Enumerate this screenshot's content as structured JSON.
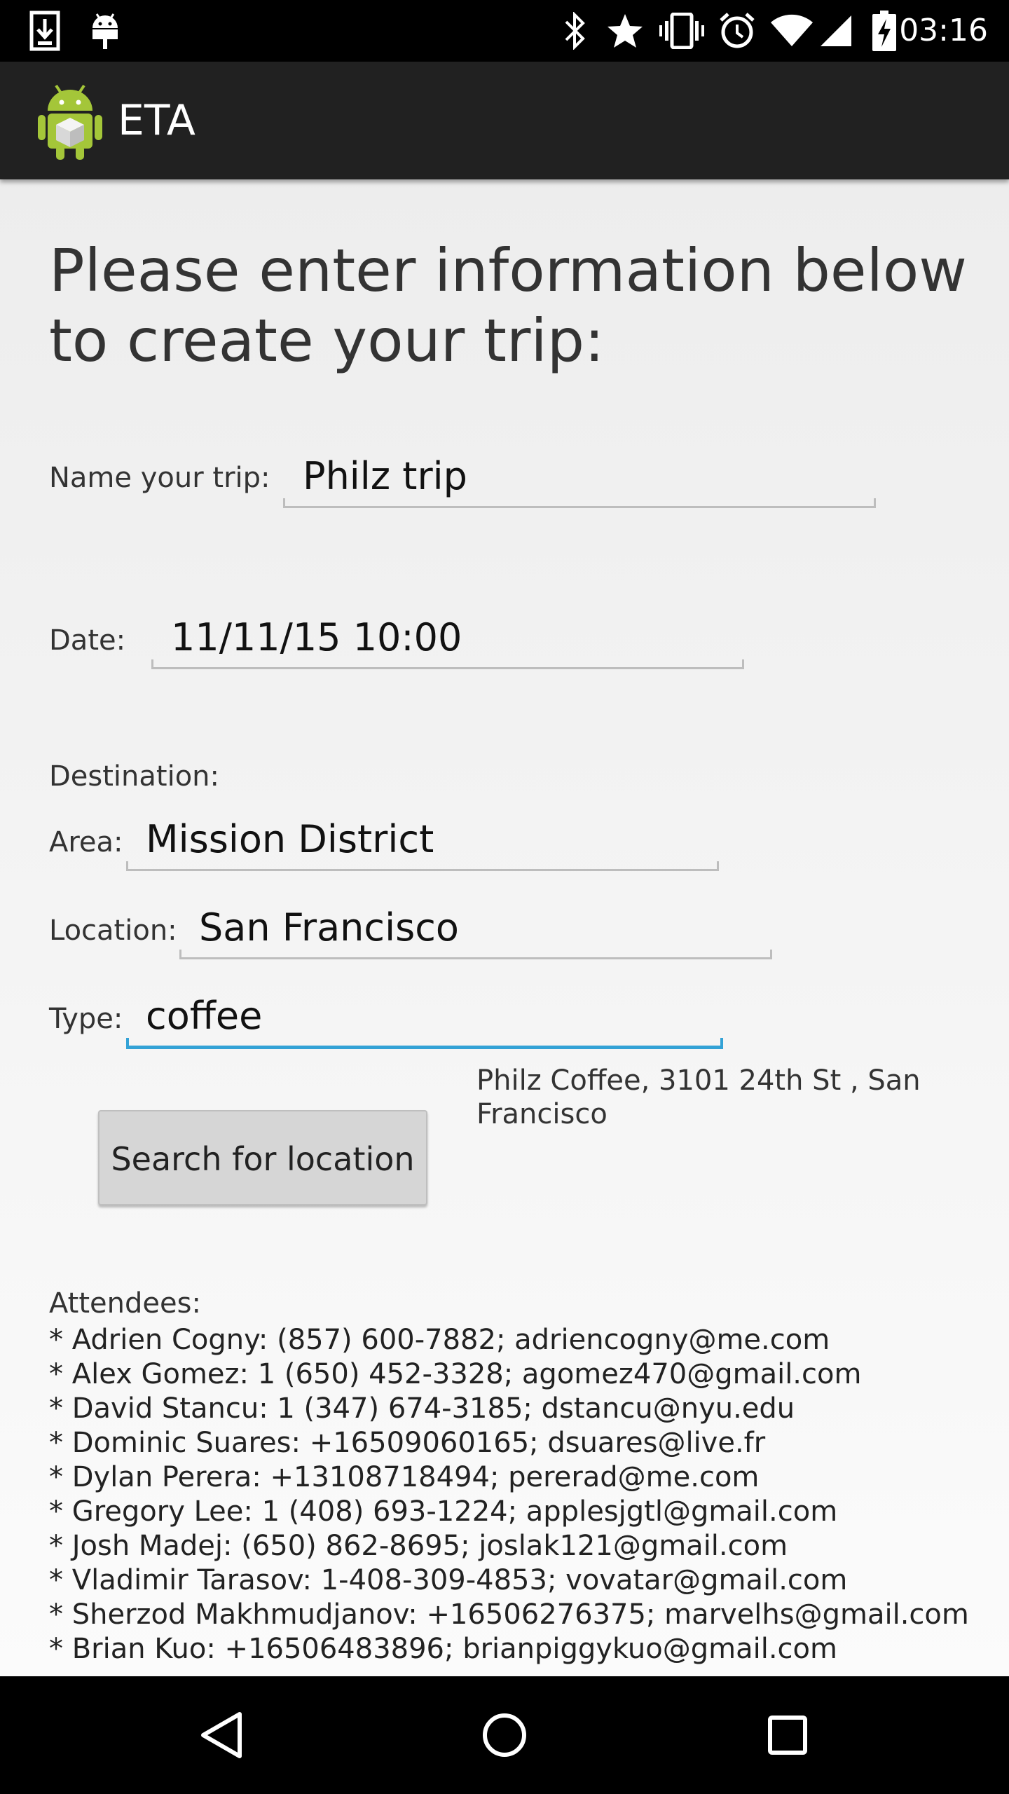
{
  "status_bar": {
    "time": "03:16",
    "left_icons": [
      "download-icon",
      "android-debug-icon"
    ],
    "right_icons": [
      "bluetooth-icon",
      "star-icon",
      "vibrate-icon",
      "alarm-icon",
      "wifi-icon",
      "signal-icon",
      "battery-charging-icon"
    ]
  },
  "app_bar": {
    "title": "ETA",
    "logo_icon": "android-app-icon"
  },
  "form": {
    "headline": "Please enter information below to create your trip:",
    "trip_name": {
      "label": "Name your trip:",
      "value": "Philz trip"
    },
    "date": {
      "label": "Date:",
      "value": "11/11/15 10:00"
    },
    "destination_label": "Destination:",
    "area": {
      "label": "Area:",
      "value": "Mission District"
    },
    "location": {
      "label": "Location:",
      "value": "San Francisco"
    },
    "type": {
      "label": "Type:",
      "value": "coffee"
    },
    "search_button_label": "Search for location",
    "search_result": "Philz Coffee, 3101 24th St , San Francisco"
  },
  "attendees": {
    "label": "Attendees:",
    "items": [
      "* Adrien Cogny: (857) 600-7882; adriencogny@me.com",
      "* Alex Gomez: 1 (650) 452-3328; agomez470@gmail.com",
      "* David Stancu: 1 (347) 674-3185; dstancu@nyu.edu",
      "* Dominic Suares: +16509060165; dsuares@live.fr",
      "* Dylan Perera: +13108718494; pererad@me.com",
      "* Gregory Lee: 1 (408) 693-1224; applesjgtl@gmail.com",
      "* Josh Madej: (650) 862-8695; joslak121@gmail.com",
      "* Vladimir Tarasov: 1-408-309-4853; vovatar@gmail.com",
      "* Sherzod Makhmudjanov: +16506276375; marvelhs@gmail.com",
      "* Brian Kuo: +16506483896; brianpiggykuo@gmail.com"
    ]
  },
  "nav_bar": {
    "icons": [
      "back-icon",
      "home-icon",
      "recents-icon"
    ]
  },
  "colors": {
    "accent": "#33a2d6",
    "action_bar": "#212121",
    "android_green": "#a4c639"
  }
}
